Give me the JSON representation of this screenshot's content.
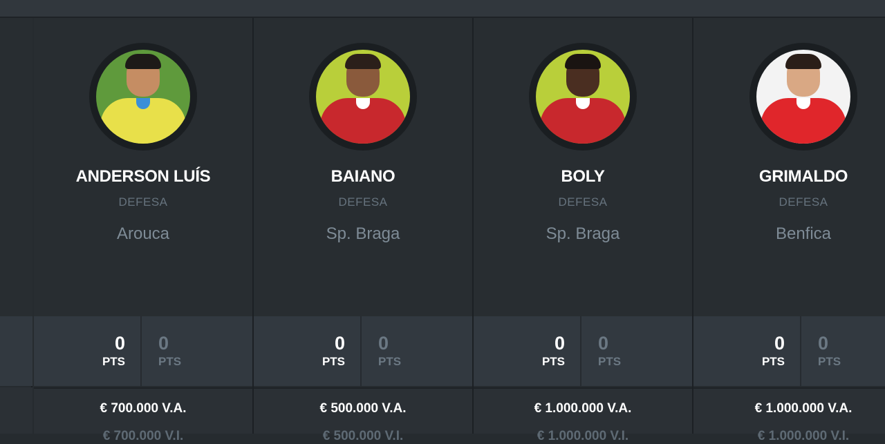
{
  "players": [
    {
      "name": "ANDERSON LUÍS",
      "position": "DEFESA",
      "team": "Arouca",
      "points": "0",
      "points_label": "PTS",
      "points2": "0",
      "points2_label": "PTS",
      "value": "€ 700.000 V.A.",
      "value2": "€ 700.000 V.I.",
      "photo_colors": {
        "bg": "#5f9a3c",
        "skin": "#c58d63",
        "hair": "#1d1a18",
        "shirt": "#e8e04a",
        "collar": "#3a8fd8"
      }
    },
    {
      "name": "BAIANO",
      "position": "DEFESA",
      "team": "Sp. Braga",
      "points": "0",
      "points_label": "PTS",
      "points2": "0",
      "points2_label": "PTS",
      "value": "€ 500.000 V.A.",
      "value2": "€ 500.000 V.I.",
      "photo_colors": {
        "bg": "#b9cf3a",
        "skin": "#8a5a3c",
        "hair": "#2b1f1a",
        "shirt": "#c8282d",
        "collar": "#ffffff"
      }
    },
    {
      "name": "BOLY",
      "position": "DEFESA",
      "team": "Sp. Braga",
      "points": "0",
      "points_label": "PTS",
      "points2": "0",
      "points2_label": "PTS",
      "value": "€ 1.000.000 V.A.",
      "value2": "€ 1.000.000 V.I.",
      "photo_colors": {
        "bg": "#b9cf3a",
        "skin": "#4a2e21",
        "hair": "#1a1412",
        "shirt": "#c8282d",
        "collar": "#ffffff"
      }
    },
    {
      "name": "GRIMALDO",
      "position": "DEFESA",
      "team": "Benfica",
      "points": "0",
      "points_label": "PTS",
      "points2": "0",
      "points2_label": "PTS",
      "value": "€ 1.000.000 V.A.",
      "value2": "€ 1.000.000 V.I.",
      "photo_colors": {
        "bg": "#f3f3f3",
        "skin": "#d9a884",
        "hair": "#2a1e18",
        "shirt": "#e0262b",
        "collar": "#ffffff"
      }
    }
  ]
}
